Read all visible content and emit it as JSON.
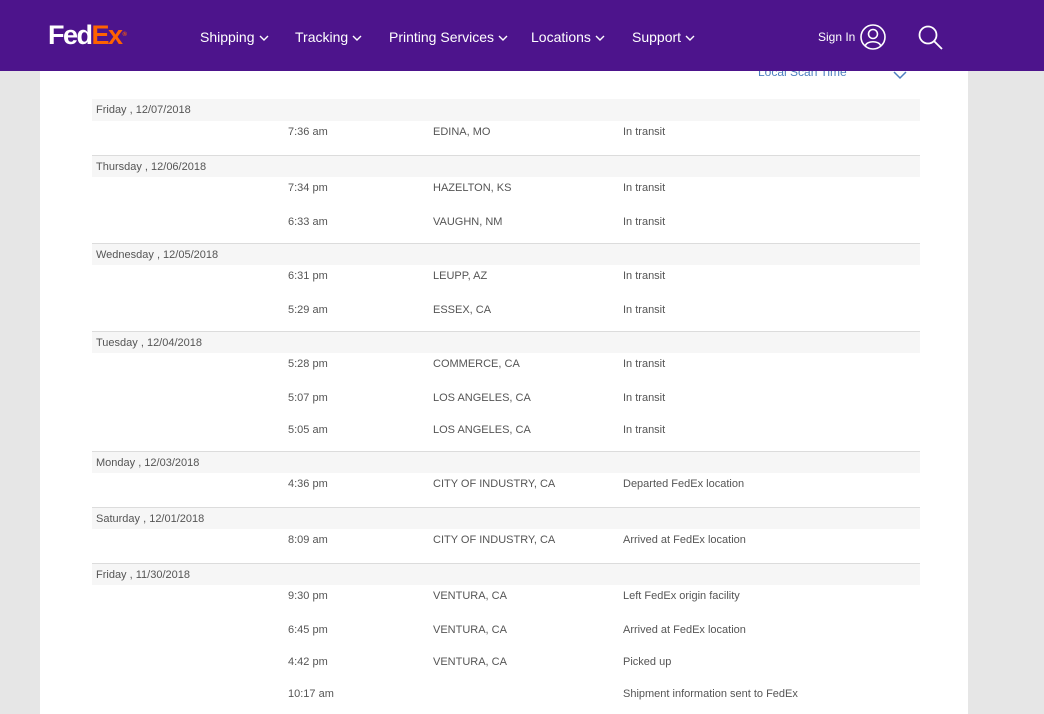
{
  "header": {
    "logo_fed": "Fed",
    "logo_ex": "Ex",
    "logo_reg": "®",
    "nav": [
      {
        "label": "Shipping"
      },
      {
        "label": "Tracking"
      },
      {
        "label": "Printing Services"
      },
      {
        "label": "Locations"
      },
      {
        "label": "Support"
      }
    ],
    "sign_in": "Sign In"
  },
  "content": {
    "scan_time_label": "Local Scan Time"
  },
  "days": [
    {
      "date": "Friday , 12/07/2018",
      "events": [
        {
          "time": "7:36 am",
          "location": "EDINA, MO",
          "status": "In transit"
        }
      ]
    },
    {
      "date": "Thursday , 12/06/2018",
      "events": [
        {
          "time": "7:34 pm",
          "location": "HAZELTON, KS",
          "status": "In transit"
        },
        {
          "time": "6:33 am",
          "location": "VAUGHN, NM",
          "status": "In transit"
        }
      ]
    },
    {
      "date": "Wednesday , 12/05/2018",
      "events": [
        {
          "time": "6:31 pm",
          "location": "LEUPP, AZ",
          "status": "In transit"
        },
        {
          "time": "5:29 am",
          "location": "ESSEX, CA",
          "status": "In transit"
        }
      ]
    },
    {
      "date": "Tuesday , 12/04/2018",
      "events": [
        {
          "time": "5:28 pm",
          "location": "COMMERCE, CA",
          "status": "In transit"
        },
        {
          "time": "5:07 pm",
          "location": "LOS ANGELES, CA",
          "status": "In transit"
        },
        {
          "time": "5:05 am",
          "location": "LOS ANGELES, CA",
          "status": "In transit"
        }
      ]
    },
    {
      "date": "Monday , 12/03/2018",
      "events": [
        {
          "time": "4:36 pm",
          "location": "CITY OF INDUSTRY, CA",
          "status": "Departed FedEx location"
        }
      ]
    },
    {
      "date": "Saturday , 12/01/2018",
      "events": [
        {
          "time": "8:09 am",
          "location": "CITY OF INDUSTRY, CA",
          "status": "Arrived at FedEx location"
        }
      ]
    },
    {
      "date": "Friday , 11/30/2018",
      "events": [
        {
          "time": "9:30 pm",
          "location": "VENTURA, CA",
          "status": "Left FedEx origin facility"
        },
        {
          "time": "6:45 pm",
          "location": "VENTURA, CA",
          "status": "Arrived at FedEx location"
        },
        {
          "time": "4:42 pm",
          "location": "VENTURA, CA",
          "status": "Picked up"
        },
        {
          "time": "10:17 am",
          "location": "",
          "status": "Shipment information sent to FedEx"
        }
      ]
    }
  ],
  "colors": {
    "brand_purple": "#4d148c",
    "brand_orange": "#ff6200",
    "link_blue": "#4d7fbf"
  }
}
